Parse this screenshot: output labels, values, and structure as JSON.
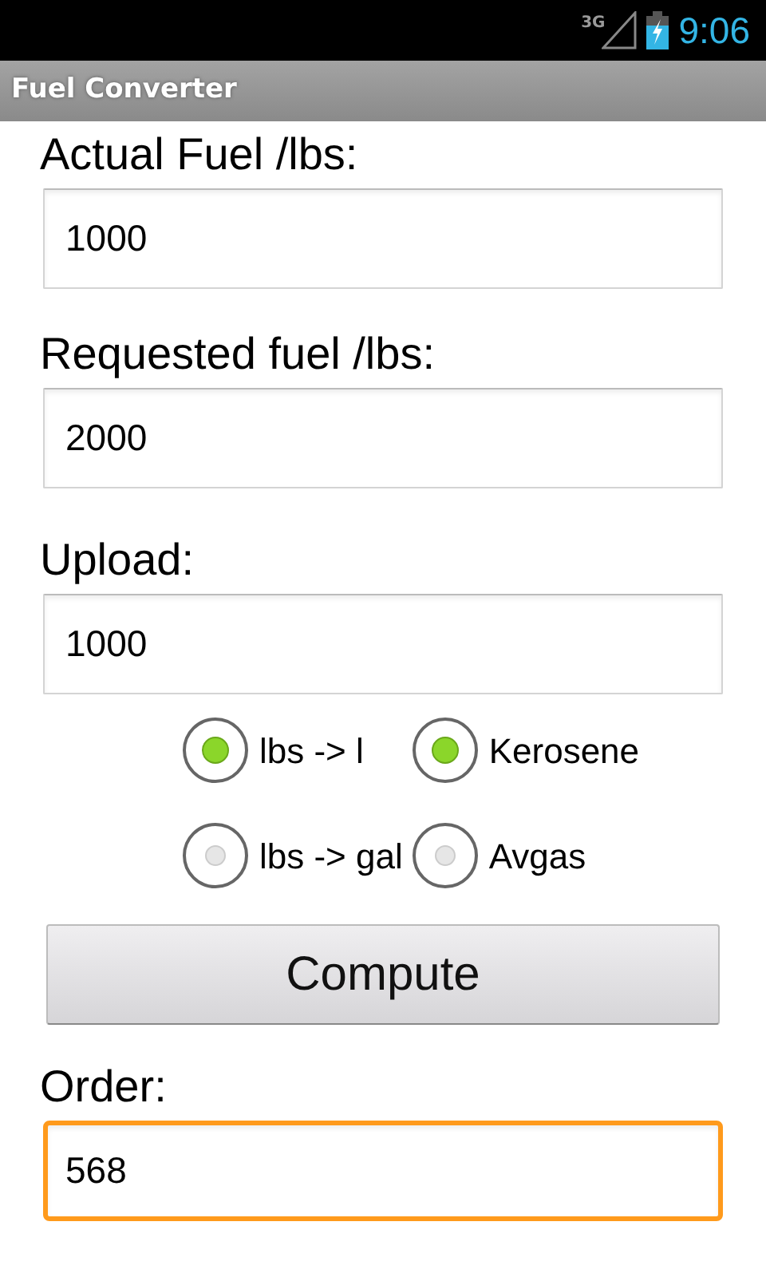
{
  "status_bar": {
    "network": "3G",
    "time": "9:06"
  },
  "title_bar": {
    "title": "Fuel Converter"
  },
  "inputs": [
    {
      "label": "Actual Fuel /lbs:",
      "value": "1000",
      "focused": false
    },
    {
      "label": "Requested fuel /lbs:",
      "value": "2000",
      "focused": false
    },
    {
      "label": "Upload:",
      "value": "1000",
      "focused": false
    }
  ],
  "radio_groups": [
    {
      "options": [
        {
          "label": "lbs -> l",
          "selected": true
        },
        {
          "label": "lbs -> gal",
          "selected": false
        }
      ]
    },
    {
      "options": [
        {
          "label": "Kerosene",
          "selected": true
        },
        {
          "label": "Avgas",
          "selected": false
        }
      ]
    }
  ],
  "button": {
    "label": "Compute"
  },
  "result": {
    "label": "Order:",
    "value": "568",
    "focused": true
  }
}
